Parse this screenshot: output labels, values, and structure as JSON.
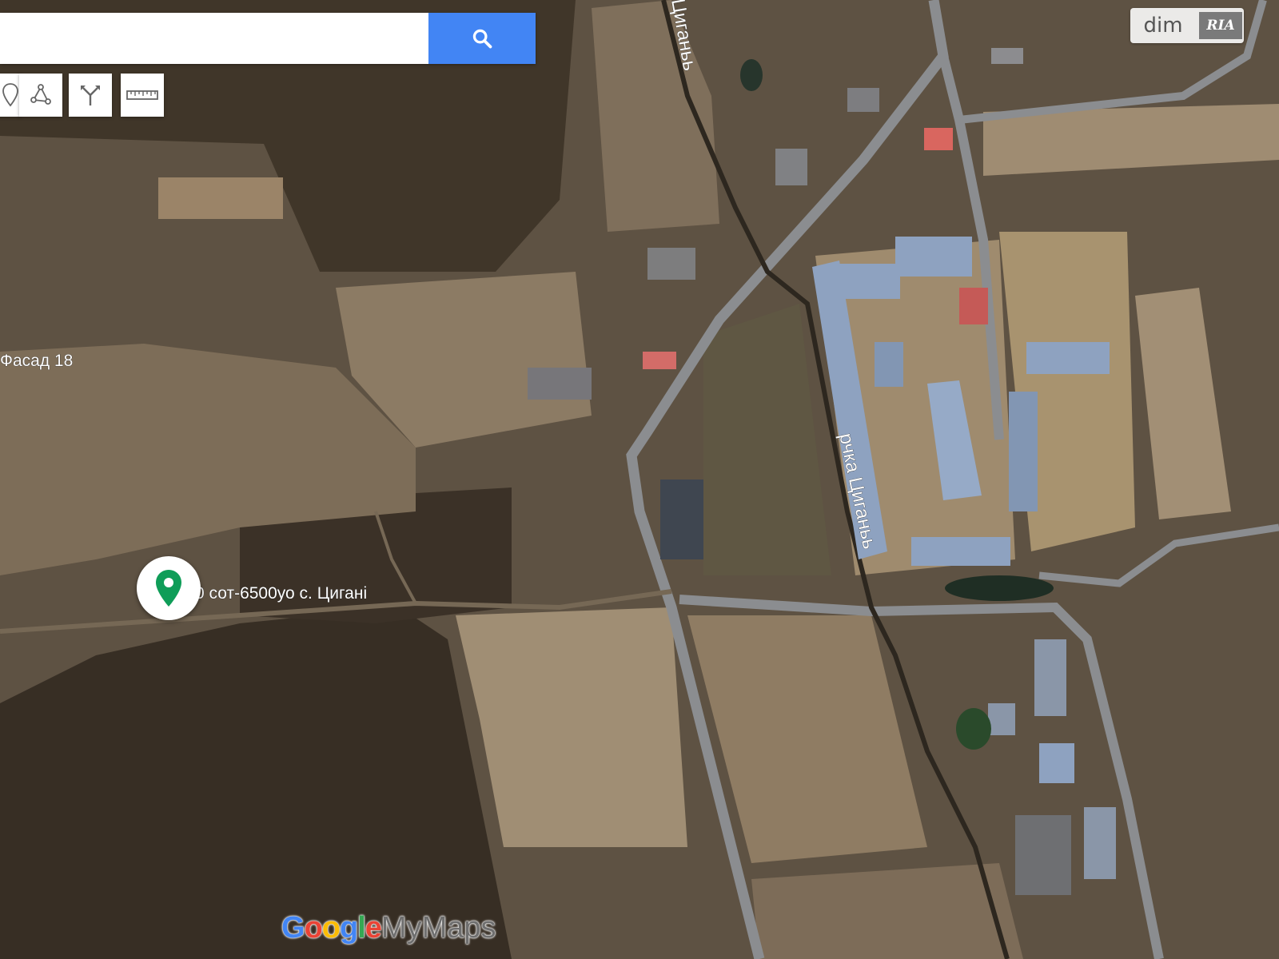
{
  "map_type": "satellite",
  "search": {
    "value": "",
    "placeholder": ""
  },
  "search_button": {
    "icon": "search-icon"
  },
  "toolbar": {
    "tools": [
      {
        "icon": "marker-icon"
      },
      {
        "icon": "draw-line-icon"
      },
      {
        "icon": "directions-icon"
      },
      {
        "icon": "ruler-icon"
      }
    ]
  },
  "labels": {
    "river_top": "Циганьь",
    "river_middle": "рчка Циганьь",
    "facade": "Фасад 18",
    "place_marker": "0 сот-6500уо с. Цигані"
  },
  "place_marker": {
    "icon": "map-pin-icon",
    "color": "#0f9d58"
  },
  "badge": {
    "dim": "dim",
    "ria": "RIA"
  },
  "logo": {
    "letters": [
      "G",
      "o",
      "o",
      "g",
      "l",
      "e"
    ],
    "colors": [
      "#4285f4",
      "#ea4335",
      "#fbbc05",
      "#4285f4",
      "#34a853",
      "#ea4335"
    ],
    "rest": "MyMaps"
  },
  "colors": {
    "road": "#8b8d90",
    "roof": "#8ea2c0",
    "field": "#9c8a70",
    "forest": "#3e342a",
    "accent": "#4285f4"
  }
}
